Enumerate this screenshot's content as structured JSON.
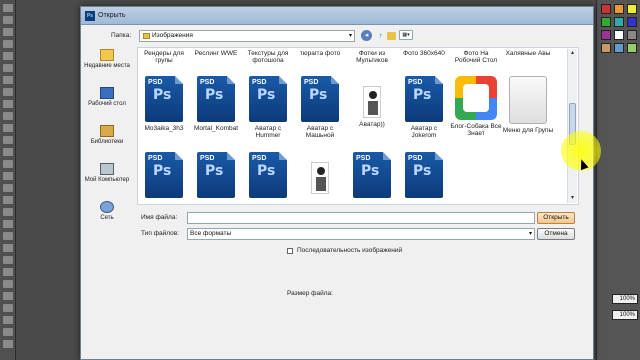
{
  "dialog": {
    "title": "Открыть",
    "ps_mini": "Ps",
    "folder_label": "Папка:",
    "folder_value": "Изображения",
    "filename_label": "Имя файла:",
    "filename_value": "",
    "filetype_label": "Тип файлов:",
    "filetype_value": "Все форматы",
    "open_label": "Открыть",
    "cancel_label": "Отмена",
    "sequence_label": "Последовательность изображений",
    "filesize_label": "Размер файла:"
  },
  "places": [
    {
      "label": "Недавние места",
      "icon": "recent-places-icon"
    },
    {
      "label": "Рабочий стол",
      "icon": "desktop-icon"
    },
    {
      "label": "Библиотеки",
      "icon": "libraries-icon"
    },
    {
      "label": "Мой Компьютер",
      "icon": "computer-icon"
    },
    {
      "label": "Сеть",
      "icon": "network-icon"
    }
  ],
  "top_names": [
    "Рендеры для групы",
    "Реслинг WWE",
    "Текстуры для фотошопа",
    "тюрагга фото",
    "Фотки из Мультиков",
    "Фото 360х640",
    "Фото На Робочий Стол",
    "Халявные Авы"
  ],
  "row1": [
    {
      "kind": "psd",
      "name": "Mo3aika_3h3"
    },
    {
      "kind": "psd",
      "name": "Mortal_Kombat"
    },
    {
      "kind": "psd",
      "name": "Аватар с Hummer"
    },
    {
      "kind": "psd",
      "name": "Аватар с Машьной"
    },
    {
      "kind": "cartoon",
      "name": "Аватар))"
    },
    {
      "kind": "psd",
      "name": "Аватар с Jokerom"
    },
    {
      "kind": "vk",
      "name": "Блог-Собака Все Знает"
    },
    {
      "kind": "menu",
      "name": "Меню для Групы"
    }
  ],
  "row2": [
    {
      "kind": "psd",
      "name": ""
    },
    {
      "kind": "psd",
      "name": ""
    },
    {
      "kind": "psd",
      "name": ""
    },
    {
      "kind": "cartoon",
      "name": ""
    },
    {
      "kind": "psd",
      "name": ""
    },
    {
      "kind": "psd",
      "name": ""
    }
  ],
  "psd_tag": "PSD",
  "ps_letters": "Ps",
  "toolbar_view": "▦▾",
  "ps_right_fields": [
    "100%",
    "100%"
  ],
  "colors": {
    "accent": "#0c3a7a",
    "open_button": "#f3c88a",
    "title_bar": "#9fb9d6"
  }
}
